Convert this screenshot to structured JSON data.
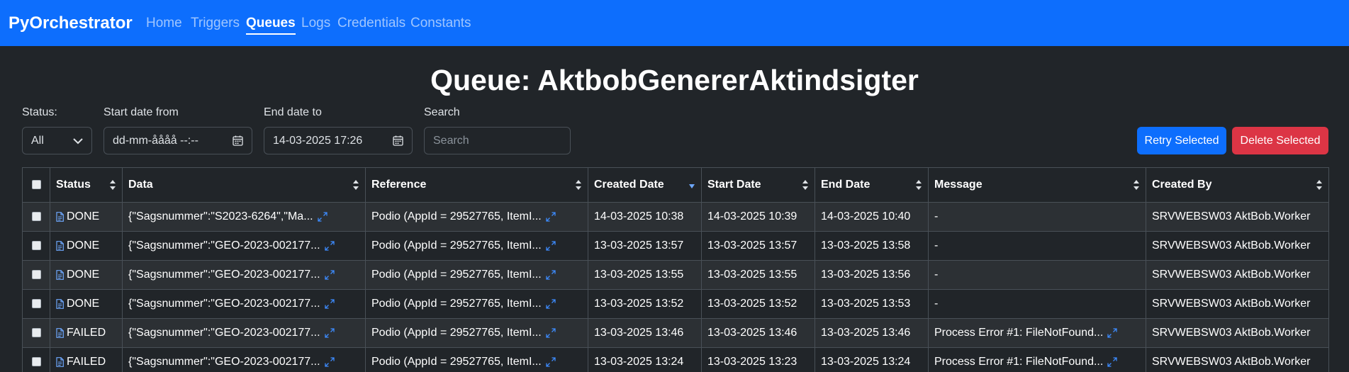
{
  "brand": "PyOrchestrator",
  "nav": [
    "Home",
    "Triggers",
    "Queues",
    "Logs",
    "Credentials",
    "Constants"
  ],
  "page_title": "Queue: AktbobGenererAktindsigter",
  "filters": {
    "status_label": "Status:",
    "status_value": "All",
    "start_label": "Start date from",
    "start_placeholder": "dd-mm-åååå --:--",
    "end_label": "End date to",
    "end_value": "14-03-2025 17:26",
    "search_label": "Search",
    "search_placeholder": "Search"
  },
  "buttons": {
    "retry": "Retry Selected",
    "delete": "Delete Selected"
  },
  "table": {
    "headers": [
      "Status",
      "Data",
      "Reference",
      "Created Date",
      "Start Date",
      "End Date",
      "Message",
      "Created By"
    ],
    "rows": [
      {
        "status": "DONE",
        "data": "{\"Sagsnummer\":\"S2023-6264\",\"Ma...",
        "reference": "Podio (AppId = 29527765, ItemI...",
        "created": "14-03-2025 10:38",
        "start": "14-03-2025 10:39",
        "end": "14-03-2025 10:40",
        "message": "-",
        "created_by": "SRVWEBSW03 AktBob.Worker"
      },
      {
        "status": "DONE",
        "data": "{\"Sagsnummer\":\"GEO-2023-002177...",
        "reference": "Podio (AppId = 29527765, ItemI...",
        "created": "13-03-2025 13:57",
        "start": "13-03-2025 13:57",
        "end": "13-03-2025 13:58",
        "message": "-",
        "created_by": "SRVWEBSW03 AktBob.Worker"
      },
      {
        "status": "DONE",
        "data": "{\"Sagsnummer\":\"GEO-2023-002177...",
        "reference": "Podio (AppId = 29527765, ItemI...",
        "created": "13-03-2025 13:55",
        "start": "13-03-2025 13:55",
        "end": "13-03-2025 13:56",
        "message": "-",
        "created_by": "SRVWEBSW03 AktBob.Worker"
      },
      {
        "status": "DONE",
        "data": "{\"Sagsnummer\":\"GEO-2023-002177...",
        "reference": "Podio (AppId = 29527765, ItemI...",
        "created": "13-03-2025 13:52",
        "start": "13-03-2025 13:52",
        "end": "13-03-2025 13:53",
        "message": "-",
        "created_by": "SRVWEBSW03 AktBob.Worker"
      },
      {
        "status": "FAILED",
        "data": "{\"Sagsnummer\":\"GEO-2023-002177...",
        "reference": "Podio (AppId = 29527765, ItemI...",
        "created": "13-03-2025 13:46",
        "start": "13-03-2025 13:46",
        "end": "13-03-2025 13:46",
        "message": "Process Error #1: FileNotFound...",
        "created_by": "SRVWEBSW03 AktBob.Worker"
      },
      {
        "status": "FAILED",
        "data": "{\"Sagsnummer\":\"GEO-2023-002177...",
        "reference": "Podio (AppId = 29527765, ItemI...",
        "created": "13-03-2025 13:24",
        "start": "13-03-2025 13:23",
        "end": "13-03-2025 13:24",
        "message": "Process Error #1: FileNotFound...",
        "created_by": "SRVWEBSW03 AktBob.Worker"
      }
    ]
  },
  "colors": {
    "navbar": "#0d6efd",
    "background": "#212529",
    "primary": "#0d6efd",
    "danger": "#dc3545"
  }
}
